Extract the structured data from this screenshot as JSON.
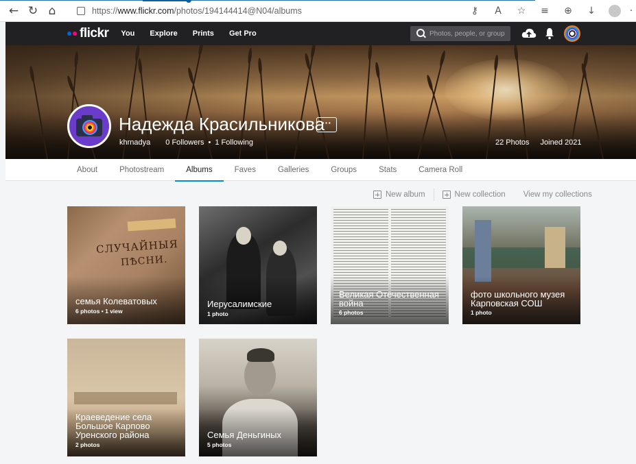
{
  "browser": {
    "url_prefix": "https://",
    "url_host": "www.flickr.com",
    "url_path": "/photos/194144414@N04/albums",
    "icons": [
      "back-arrow-icon",
      "refresh-icon",
      "home-icon",
      "lock-icon",
      "key-icon",
      "read-aloud-icon",
      "favorite-icon",
      "favorites-list-icon",
      "collections-icon",
      "downloads-icon",
      "profile-icon"
    ]
  },
  "topnav": {
    "logo": "flickr",
    "links": [
      "You",
      "Explore",
      "Prints",
      "Get Pro"
    ],
    "search_placeholder": "Photos, people, or groups",
    "brand_blue": "#0063dc",
    "brand_pink": "#ff0084"
  },
  "profile": {
    "name": "Надежда Красильникова",
    "username": "khrnadya",
    "followers": "0 Followers",
    "separator": "•",
    "following": "1 Following",
    "photos": "22 Photos",
    "joined": "Joined 2021",
    "more_label": "···"
  },
  "tabs": [
    {
      "label": "About"
    },
    {
      "label": "Photostream"
    },
    {
      "label": "Albums",
      "active": true
    },
    {
      "label": "Faves"
    },
    {
      "label": "Galleries"
    },
    {
      "label": "Groups"
    },
    {
      "label": "Stats"
    },
    {
      "label": "Camera Roll"
    }
  ],
  "actions": {
    "new_album": "New album",
    "new_collection": "New collection",
    "view_collections": "View my collections"
  },
  "albums": [
    {
      "title": "семья Колеватовых",
      "meta": "6 photos  •  1 view"
    },
    {
      "title": "Иерусалимские",
      "meta": "1 photo"
    },
    {
      "title": "Великая Отечественная война",
      "meta": "6 photos"
    },
    {
      "title": "фото школьного музея Карповская СОШ",
      "meta": "1 photo"
    },
    {
      "title": "Краеведение села Большое Карпово Уренского района",
      "meta": "2 photos"
    },
    {
      "title": "Семья Деньгиных",
      "meta": "5 photos"
    }
  ],
  "book_cover": {
    "line1": "СЛУЧАЙНЫЯ",
    "line2": "ПѢСНИ."
  },
  "accent": "#008ecf"
}
